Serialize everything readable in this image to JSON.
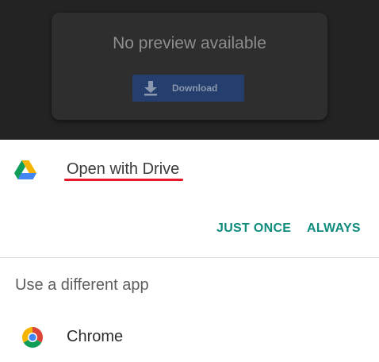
{
  "preview": {
    "message": "No preview available",
    "download_label": "Download",
    "download_icon": "download-arrow-icon"
  },
  "sheet": {
    "title": "Open with Drive",
    "title_icon": "google-drive-icon",
    "highlight_color": "#e6192b",
    "actions": {
      "just_once": "JUST ONCE",
      "always": "ALWAYS"
    },
    "accent_color": "#0e8c7e",
    "other_apps_heading": "Use a different app",
    "apps": [
      {
        "name": "Chrome",
        "icon": "chrome-icon"
      }
    ]
  }
}
